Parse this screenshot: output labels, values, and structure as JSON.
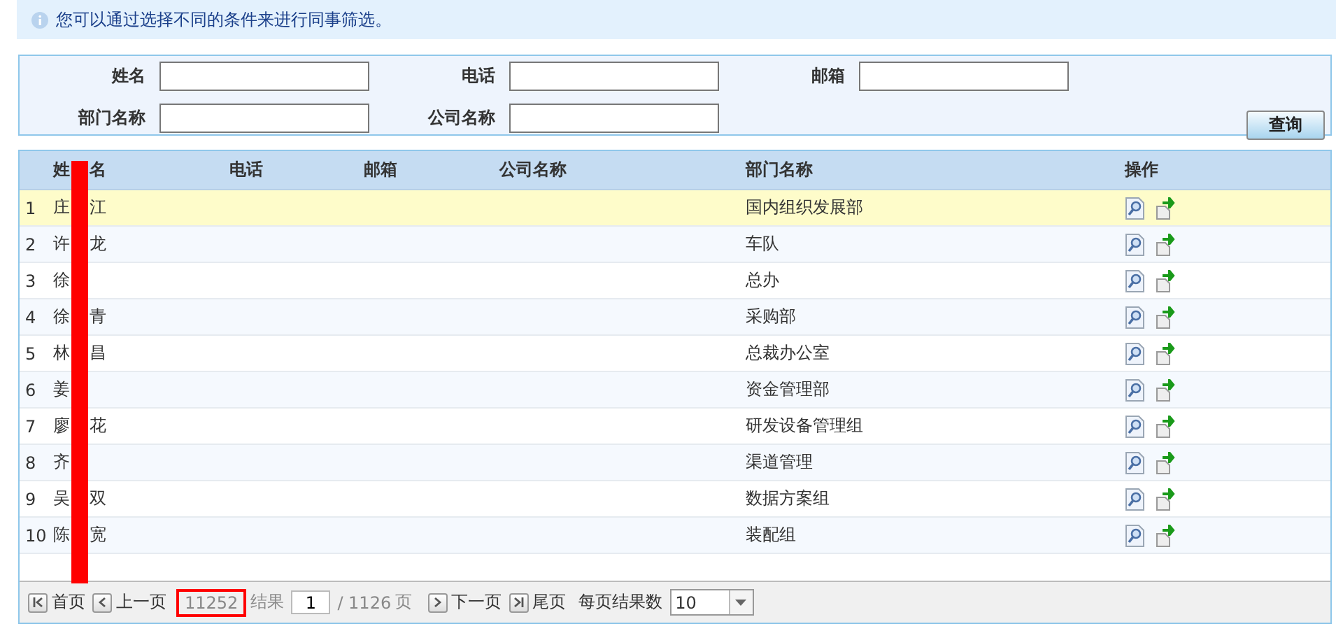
{
  "info": "您可以通过选择不同的条件来进行同事筛选。",
  "search": {
    "fields": [
      {
        "label": "姓名"
      },
      {
        "label": "电话"
      },
      {
        "label": "邮箱"
      },
      {
        "label": "部门名称"
      },
      {
        "label": "公司名称"
      }
    ],
    "button": "查询"
  },
  "table": {
    "columns": [
      {
        "start": "姓",
        "end": "名"
      },
      {
        "label": "电话"
      },
      {
        "label": "邮箱"
      },
      {
        "label": "公司名称"
      },
      {
        "label": "部门名称"
      },
      {
        "label": "操作"
      }
    ],
    "rows": [
      {
        "index": "1",
        "name_start": "庄",
        "name_end": "江",
        "department": "国内组织发展部",
        "selected": true
      },
      {
        "index": "2",
        "name_start": "许",
        "name_end": "龙",
        "department": "车队",
        "selected": false
      },
      {
        "index": "3",
        "name_start": "徐",
        "department": "总办",
        "selected": false
      },
      {
        "index": "4",
        "name_start": "徐",
        "name_end": "青",
        "department": "采购部",
        "selected": false
      },
      {
        "index": "5",
        "name_start": "林",
        "name_end": "昌",
        "department": "总裁办公室",
        "selected": false
      },
      {
        "index": "6",
        "name_start": "姜",
        "department": "资金管理部",
        "selected": false
      },
      {
        "index": "7",
        "name_start": "廖",
        "name_end": "花",
        "department": "研发设备管理组",
        "selected": false
      },
      {
        "index": "8",
        "name_start": "齐",
        "department": "渠道管理",
        "selected": false
      },
      {
        "index": "9",
        "name_start": "吴",
        "name_end": "双",
        "department": "数据方案组",
        "selected": false
      },
      {
        "index": "10",
        "name_start": "陈",
        "name_end": "宽",
        "department": "装配组",
        "selected": false
      }
    ]
  },
  "pager": {
    "first": "首页",
    "prev": "上一页",
    "total": "11252",
    "total_label": "结果",
    "page": "1",
    "of_pages": "/ 1126",
    "page_unit": "页",
    "next": "下一页",
    "last": "尾页",
    "per_page_label": "每页结果数",
    "per_page": "10"
  }
}
